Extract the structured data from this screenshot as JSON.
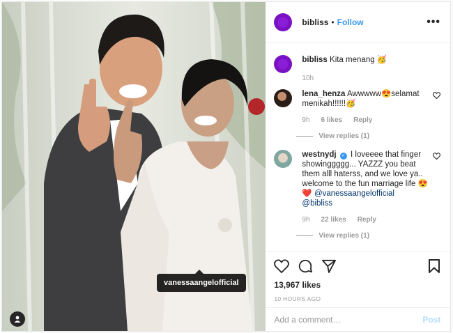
{
  "post": {
    "username": "bibliss",
    "follow_label": "Follow",
    "separator": "•",
    "more_label": "•••",
    "photo_tag": "vanessaangelofficial",
    "caption": {
      "username": "bibliss",
      "text": "Kita menang 🥳",
      "time": "10h"
    },
    "comments": [
      {
        "username": "lena_henza",
        "text": "Awwwww😍selamat menikah!!!!!!🥳",
        "time": "9h",
        "likes": "6 likes",
        "reply_label": "Reply",
        "view_replies": "View replies (1)"
      },
      {
        "username": "westnydj",
        "verified": "✓",
        "text": "I loveeee that finger showinggggg... YAZZZ you beat them alll haterss, and we love ya.. welcome to the fun marriage life 😍❤️",
        "mention1": "@vanessaangelofficial",
        "mention2": "@bibliss",
        "time": "9h",
        "likes": "22 likes",
        "reply_label": "Reply",
        "view_replies": "View replies (1)"
      }
    ],
    "likes_count": "13,967 likes",
    "timestamp": "10 HOURS AGO",
    "comment_placeholder": "Add a comment…",
    "post_button": "Post",
    "icons": [
      "heart-icon",
      "comment-icon",
      "share-icon",
      "bookmark-icon",
      "user-tag-icon"
    ],
    "colors": {
      "link": "#3897f0",
      "avatar": "#8a1ed6",
      "post_disabled": "#b2dffc"
    }
  }
}
